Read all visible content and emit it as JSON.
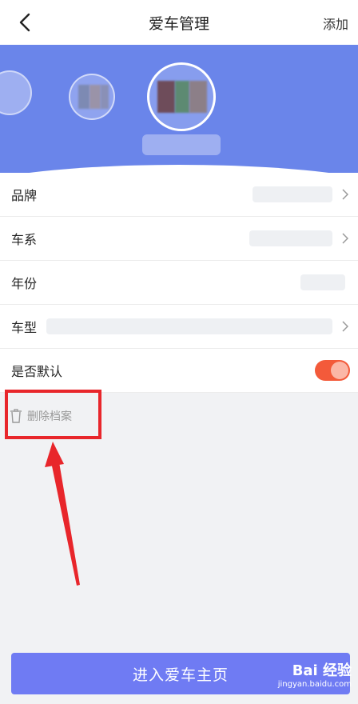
{
  "header": {
    "title": "爱车管理",
    "action_label": "添加"
  },
  "rows": [
    {
      "label": "品牌"
    },
    {
      "label": "车系"
    },
    {
      "label": "年份"
    },
    {
      "label": "车型"
    },
    {
      "label": "是否默认"
    }
  ],
  "default_toggle": {
    "on": true
  },
  "delete": {
    "label": "删除档案"
  },
  "enter_button": {
    "label": "进入爱车主页"
  },
  "watermark": {
    "logo": "Bai 经验",
    "url": "jingyan.baidu.com"
  },
  "colors": {
    "hero": "#6a85ea",
    "button": "#6f7bf3",
    "toggle": "#f35a3a",
    "annotation": "#e8262b"
  },
  "icons": [
    "back-arrow-icon",
    "chevron-right-icon",
    "trash-icon"
  ]
}
